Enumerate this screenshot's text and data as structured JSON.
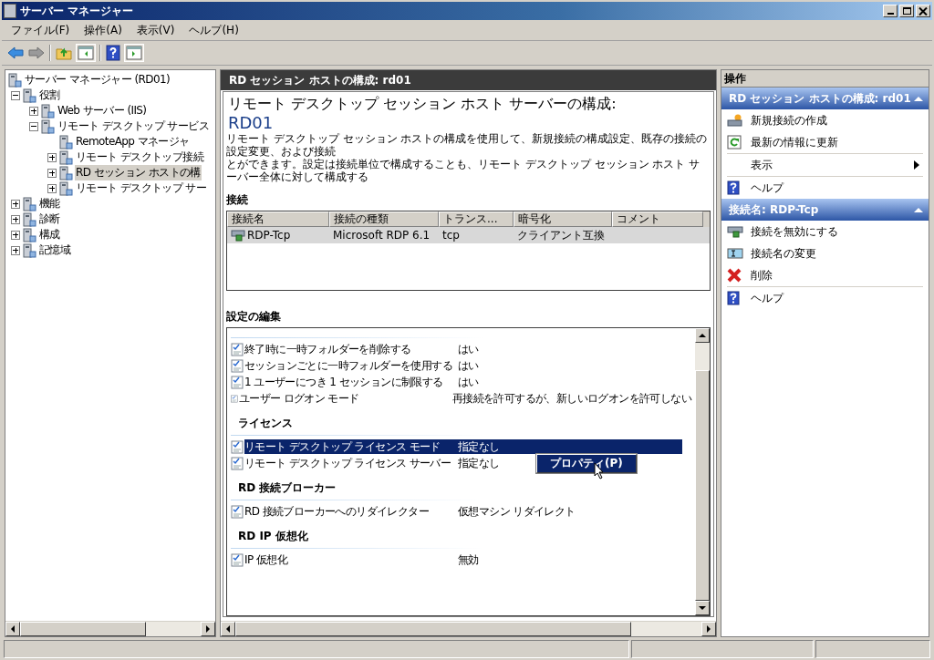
{
  "window": {
    "title": "サーバー マネージャー"
  },
  "menu": [
    "ファイル(F)",
    "操作(A)",
    "表示(V)",
    "ヘルプ(H)"
  ],
  "tree": [
    {
      "label": "サーバー マネージャー (RD01)",
      "selected": false,
      "children": [
        {
          "label": "役割",
          "selected": false,
          "expanded": true,
          "children": [
            {
              "label": "Web サーバー (IIS)",
              "selected": false,
              "expanded": false
            },
            {
              "label": "リモート デスクトップ サービス",
              "selected": false,
              "expanded": true,
              "children": [
                {
                  "label": "RemoteApp マネージャ",
                  "selected": false
                },
                {
                  "label": "リモート デスクトップ接続",
                  "selected": false,
                  "expanded": false
                },
                {
                  "label": "RD セッション ホストの構",
                  "selected": true,
                  "expanded": false
                },
                {
                  "label": "リモート デスクトップ サー",
                  "selected": false,
                  "expanded": false
                }
              ]
            }
          ]
        },
        {
          "label": "機能",
          "selected": false,
          "expanded": false
        },
        {
          "label": "診断",
          "selected": false,
          "expanded": false
        },
        {
          "label": "構成",
          "selected": false,
          "expanded": false
        },
        {
          "label": "記憶域",
          "selected": false,
          "expanded": false
        }
      ]
    }
  ],
  "center": {
    "header": "RD セッション ホストの構成: rd01",
    "title": "リモート デスクトップ セッション ホスト サーバーの構成:",
    "server": "RD01",
    "description": [
      "リモート デスクトップ セッション ホストの構成を使用して、新規接続の構成設定、既存の接続の設定変更、および接続",
      "とができます。設定は接続単位で構成することも、リモート デスクトップ セッション ホスト サーバー全体に対して構成する"
    ],
    "connections": {
      "heading": "接続",
      "columns": [
        "接続名",
        "接続の種類",
        "トランス...",
        "暗号化",
        "コメント"
      ],
      "rows": [
        {
          "cells": [
            "RDP-Tcp",
            "Microsoft RDP 6.1",
            "tcp",
            "クライアント互換"
          ],
          "selected": true
        }
      ]
    },
    "settings": {
      "heading": "設定の編集",
      "groups": [
        {
          "items": [
            {
              "label": "終了時に一時フォルダーを削除する",
              "value": "はい",
              "selected": false
            },
            {
              "label": "セッションごとに一時フォルダーを使用する",
              "value": "はい",
              "selected": false
            },
            {
              "label": "1 ユーザーにつき 1 セッションに制限する",
              "value": "はい",
              "selected": false
            },
            {
              "label": "ユーザー ログオン モード",
              "value": "再接続を許可するが、新しいログオンを許可しない",
              "selected": false
            }
          ]
        },
        {
          "title": "ライセンス",
          "items": [
            {
              "label": "リモート デスクトップ ライセンス モード",
              "value": "指定なし",
              "selected": true
            },
            {
              "label": "リモート デスクトップ ライセンス サーバー",
              "value": "指定なし",
              "selected": false
            }
          ]
        },
        {
          "title": "RD 接続ブローカー",
          "items": [
            {
              "label": "RD 接続ブローカーへのリダイレクター",
              "value": "仮想マシン リダイレクト",
              "selected": false
            }
          ]
        },
        {
          "title": "RD IP 仮想化",
          "items": [
            {
              "label": "IP 仮想化",
              "value": "無効",
              "selected": false
            }
          ]
        }
      ]
    },
    "context_menu": {
      "items": [
        "プロパティ(P)"
      ]
    }
  },
  "actions": {
    "header": "操作",
    "sections": [
      {
        "title": "RD セッション ホストの構成: rd01",
        "expanded": true,
        "items": [
          {
            "kind": "create",
            "label": "新規接続の作成"
          },
          {
            "kind": "refresh",
            "label": "最新の情報に更新"
          },
          {
            "kind": "submenu",
            "label": "表示"
          },
          {
            "kind": "help",
            "label": "ヘルプ"
          }
        ]
      },
      {
        "title": "接続名: RDP-Tcp",
        "expanded": true,
        "items": [
          {
            "kind": "disable",
            "label": "接続を無効にする"
          },
          {
            "kind": "rename",
            "label": "接続名の変更"
          },
          {
            "kind": "delete",
            "label": "削除"
          },
          {
            "kind": "help",
            "label": "ヘルプ"
          }
        ]
      }
    ]
  }
}
